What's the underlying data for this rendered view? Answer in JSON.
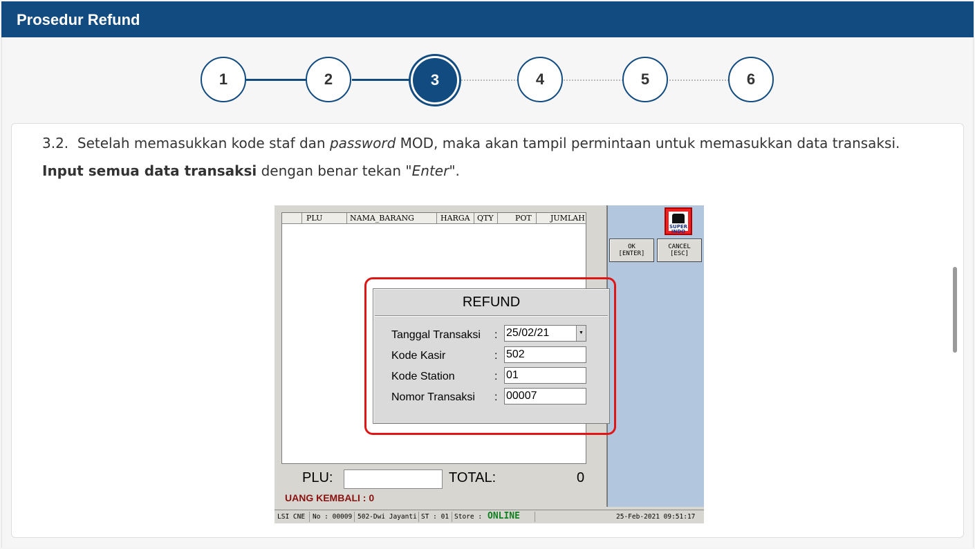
{
  "header": {
    "title": "Prosedur Refund"
  },
  "steps": [
    {
      "label": "1",
      "state": "done"
    },
    {
      "label": "2",
      "state": "done"
    },
    {
      "label": "3",
      "state": "active"
    },
    {
      "label": "4",
      "state": "todo"
    },
    {
      "label": "5",
      "state": "todo"
    },
    {
      "label": "6",
      "state": "todo"
    }
  ],
  "instruction": {
    "number": "3.2.",
    "part1": "Setelah memasukkan kode staf dan ",
    "italic1": "password",
    "part2": " MOD, maka akan tampil permintaan untuk memasukkan data transaksi. ",
    "bold1": "Input semua data transaksi",
    "part3": " dengan benar tekan \"",
    "italic2": "Enter",
    "part4": "\"."
  },
  "pos": {
    "columns": [
      "PLU",
      "NAMA_BARANG",
      "HARGA",
      "QTY",
      "POT",
      "JUMLAH"
    ],
    "logo_text": "SUPER INDO",
    "ok_button": [
      "OK",
      "[ENTER]"
    ],
    "cancel_button": [
      "CANCEL",
      "[ESC]"
    ],
    "plu_label": "PLU:",
    "total_label": "TOTAL:",
    "total_value": "0",
    "kembali": "UANG KEMBALI : 0",
    "status": {
      "app": "LSI CNE",
      "no": "No : 00009",
      "cashier": "502-Dwi Jayanti",
      "st": "ST : 01",
      "store": "Store :",
      "online": "ONLINE",
      "datetime": "25-Feb-2021 09:51:17"
    },
    "dialog": {
      "title": "REFUND",
      "fields": [
        {
          "label": "Tanggal Transaksi",
          "value": "25/02/21"
        },
        {
          "label": "Kode Kasir",
          "value": "502"
        },
        {
          "label": "Kode Station",
          "value": "01"
        },
        {
          "label": "Nomor Transaksi",
          "value": "00007"
        }
      ],
      "colon": ":"
    }
  },
  "colors": {
    "brand": "#124b80",
    "highlight": "#e01616",
    "online": "#0f7f1f",
    "kembali": "#8b1010"
  }
}
